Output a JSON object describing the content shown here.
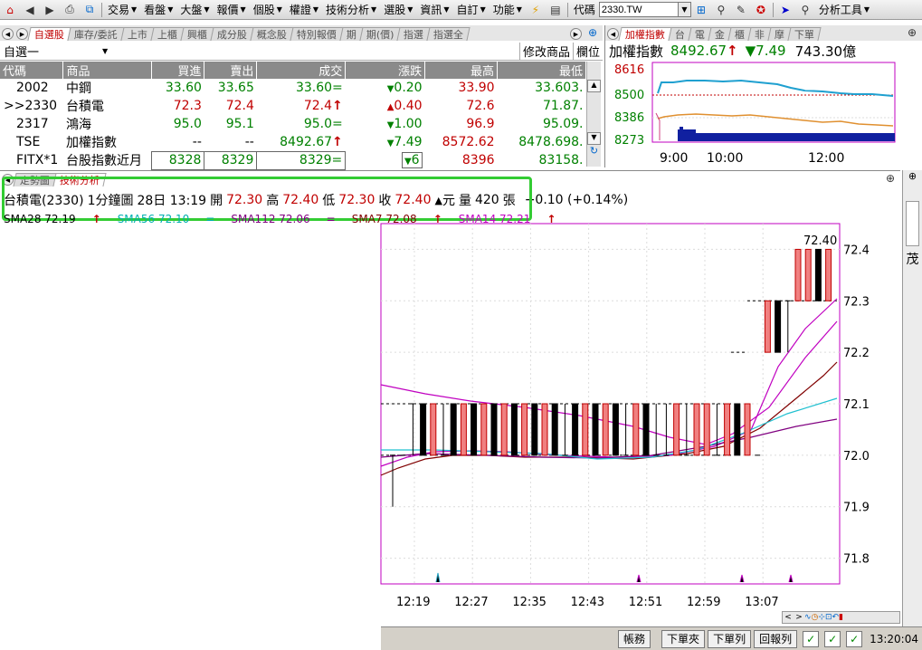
{
  "toolbar": {
    "menus": [
      "交易",
      "看盤",
      "大盤",
      "報價",
      "個股",
      "權證",
      "技術分析",
      "選股",
      "資訊",
      "自訂",
      "功能"
    ],
    "code_label": "代碼",
    "code_value": "2330.TW",
    "analysis_tools": "分析工具"
  },
  "watch_tabs": [
    "自選股",
    "庫存/委託",
    "上市",
    "上櫃",
    "興櫃",
    "成分股",
    "概念股",
    "特別報價",
    "期",
    "期(價)",
    "指選",
    "指選全"
  ],
  "watchlist": {
    "list_name": "自選一",
    "edit_button": "修改商品",
    "column_button": "欄位",
    "columns": [
      "代碼",
      "商品",
      "買進",
      "賣出",
      "成交",
      "漲跌",
      "最高",
      "最低"
    ],
    "rows": [
      {
        "code": "2002",
        "name": "中鋼",
        "bid": "33.60",
        "ask": "33.65",
        "last": "33.60=",
        "chg": "0.20",
        "dir": "down",
        "high": "33.90",
        "low": "33.603."
      },
      {
        "code": ">>2330",
        "name": "台積電",
        "bid": "72.3",
        "ask": "72.4",
        "last": "72.4",
        "chg": "0.40",
        "dir": "up",
        "high": "72.6",
        "low": "71.87."
      },
      {
        "code": "2317",
        "name": "鴻海",
        "bid": "95.0",
        "ask": "95.1",
        "last": "95.0=",
        "chg": "1.00",
        "dir": "down",
        "high": "96.9",
        "low": "95.09."
      },
      {
        "code": "TSE",
        "name": "加權指數",
        "bid": "--",
        "ask": "--",
        "last": "8492.67",
        "chg": "7.49",
        "dir": "down",
        "high": "8572.62",
        "low": "8478.698."
      },
      {
        "code": "FITX*1",
        "name": "台股指數近月",
        "bid": "8328",
        "ask": "8329",
        "last": "8329=",
        "chg": "6",
        "dir": "down",
        "high": "8396",
        "low": "83158."
      }
    ]
  },
  "index_tabs": [
    "加權指數",
    "台",
    "電",
    "金",
    "櫃",
    "非",
    "摩",
    "下單"
  ],
  "index_panel": {
    "name": "加權指數",
    "value": "8492.67",
    "change": "7.49",
    "volume": "743.30億",
    "y_labels": [
      "8616",
      "8500",
      "8386",
      "8273"
    ],
    "x_labels": [
      "9:00",
      "10:00",
      "12:00"
    ]
  },
  "chart_tabs": [
    "走勢圖",
    "技術分析"
  ],
  "chart_info": {
    "stock": "台積電(2330)",
    "period": "1分鐘圖",
    "datetime": "28日 13:19",
    "open_label": "開",
    "open": "72.30",
    "high_label": "高",
    "high": "72.40",
    "low_label": "低",
    "low": "72.30",
    "close_label": "收",
    "close": "72.40",
    "unit": "元",
    "vol_label": "量",
    "vol": "420",
    "vol_unit": "張",
    "change": "+0.10 (+0.14%)"
  },
  "ma_labels": [
    {
      "text": "SMA28 72.19",
      "color": "#000000"
    },
    {
      "text": "SMA56 72.10",
      "color": "#00b0b0"
    },
    {
      "text": "SMA112 72.06",
      "color": "#800080"
    },
    {
      "text": "SMA7 72.08",
      "color": "#800000"
    },
    {
      "text": "SMA14 72.21",
      "color": "#c000c0"
    }
  ],
  "side_label": "茂",
  "bottom_buttons": [
    "帳務",
    "下單夾",
    "下單列",
    "回報列"
  ],
  "clock": "13:20:04",
  "colors": {
    "up": "#c00000",
    "down": "#008000",
    "highlight": "#33cc33"
  },
  "chart_data": {
    "type": "candlestick",
    "yticks": [
      72.4,
      72.3,
      72.2,
      72.1,
      72.0,
      71.9,
      71.8
    ],
    "ylim": [
      71.75,
      72.45
    ],
    "xticks": [
      "12:19",
      "12:27",
      "12:35",
      "12:43",
      "12:51",
      "12:59",
      "13:07"
    ],
    "annotation": "72.40"
  }
}
